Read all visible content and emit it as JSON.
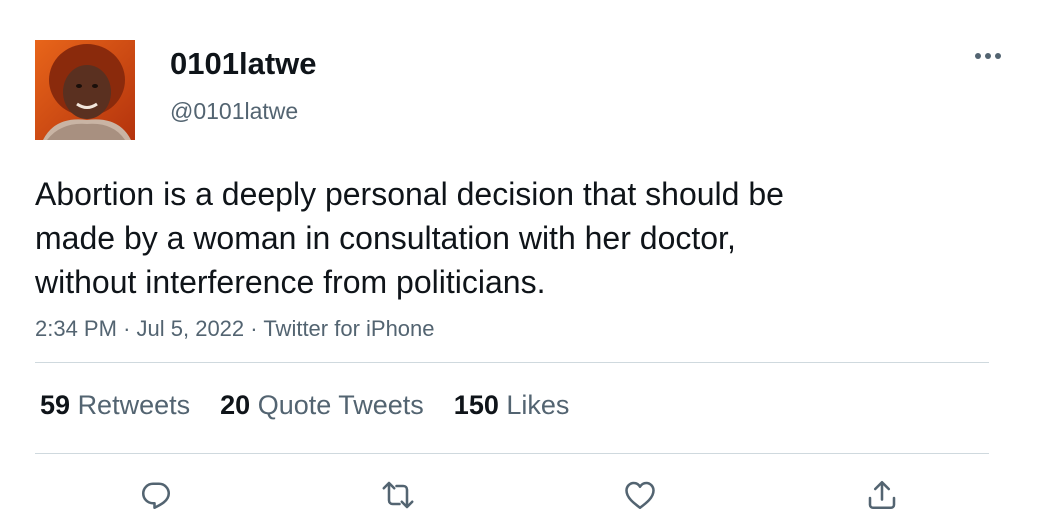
{
  "user": {
    "display_name": "0101latwe",
    "handle": "@0101latwe",
    "avatar_icon": "profile-photo"
  },
  "tweet": {
    "text": "Abortion is a deeply personal decision that should be\nmade by a woman in consultation with her doctor,\nwithout interference from politicians.",
    "time": "2:34 PM",
    "date": "Jul 5, 2022",
    "source": "Twitter for iPhone"
  },
  "stats": {
    "retweets": {
      "count": "59",
      "label": "Retweets"
    },
    "quote_tweets": {
      "count": "20",
      "label": "Quote Tweets"
    },
    "likes": {
      "count": "150",
      "label": "Likes"
    }
  },
  "actions": {
    "reply_icon": "speech-bubble-icon",
    "retweet_icon": "retweet-arrows-icon",
    "like_icon": "heart-icon",
    "share_icon": "share-upload-icon"
  },
  "colors": {
    "text_primary": "#0f1419",
    "text_secondary": "#536471",
    "divider": "#cfd9de"
  }
}
